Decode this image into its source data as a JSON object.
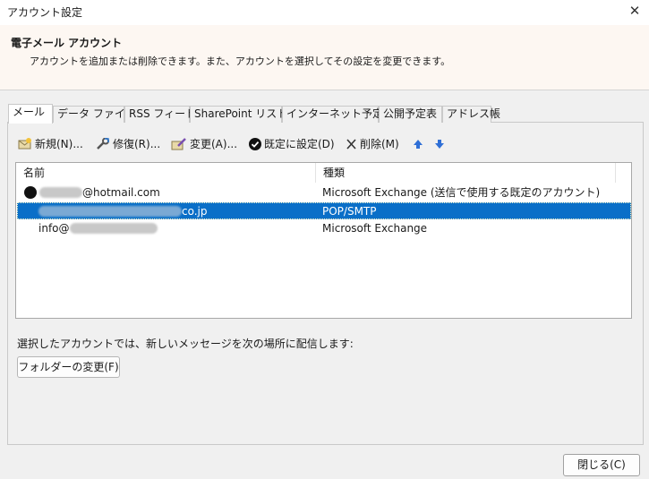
{
  "window": {
    "title": "アカウント設定"
  },
  "header": {
    "title": "電子メール アカウント",
    "description": "アカウントを追加または削除できます。また、アカウントを選択してその設定を変更できます。"
  },
  "tabs": [
    {
      "label": "メール",
      "active": true
    },
    {
      "label": "データ ファイル"
    },
    {
      "label": "RSS フィード"
    },
    {
      "label": "SharePoint リスト"
    },
    {
      "label": "インターネット予定表"
    },
    {
      "label": "公開予定表"
    },
    {
      "label": "アドレス帳"
    }
  ],
  "toolbar": {
    "new_label": "新規(N)...",
    "repair_label": "修復(R)...",
    "change_label": "変更(A)...",
    "default_label": "既定に設定(D)",
    "delete_label": "削除(M)"
  },
  "list": {
    "columns": {
      "name": "名前",
      "type": "種類"
    },
    "rows": [
      {
        "name_visible": "@hotmail.com",
        "type": "Microsoft Exchange (送信で使用する既定のアカウント)",
        "default": true
      },
      {
        "name_visible": "co.jp",
        "type": "POP/SMTP",
        "selected": true
      },
      {
        "name_visible": "info@",
        "type": "Microsoft Exchange"
      }
    ]
  },
  "deliver_text": "選択したアカウントでは、新しいメッセージを次の場所に配信します:",
  "folder_button_label": "フォルダーの変更(F)",
  "close_button_label": "閉じる(C)",
  "colors": {
    "selection": "#0a6fc8",
    "arrow": "#2f6fd6"
  }
}
